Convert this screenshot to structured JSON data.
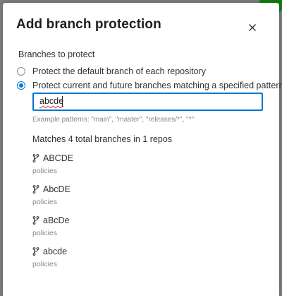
{
  "dialog": {
    "title": "Add branch protection",
    "close_icon": "close-icon"
  },
  "branches": {
    "section_label": "Branches to protect",
    "options": [
      {
        "label": "Protect the default branch of each repository",
        "selected": false
      },
      {
        "label": "Protect current and future branches matching a specified pattern",
        "selected": true
      }
    ],
    "pattern_value": "abcde",
    "hint": "Example patterns: \"main\", \"master\", \"releases/*\", \"*\"",
    "match_summary": "Matches 4 total branches in 1 repos",
    "matches": [
      {
        "name": "ABCDE",
        "sub": "policies"
      },
      {
        "name": "AbcDE",
        "sub": "policies"
      },
      {
        "name": "aBcDe",
        "sub": "policies"
      },
      {
        "name": "abcde",
        "sub": "policies"
      }
    ]
  },
  "colors": {
    "accent": "#0078d4",
    "spellcheck": "#d13438",
    "avatar": "#107c10"
  }
}
